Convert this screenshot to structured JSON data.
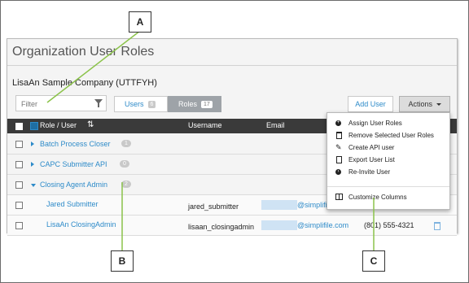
{
  "page": {
    "title": "Organization User Roles",
    "company": "LisaAn Sample Company (UTTFYH)"
  },
  "toolbar": {
    "filter_placeholder": "Filter",
    "users_tab": {
      "label": "Users",
      "count": "6"
    },
    "roles_tab": {
      "label": "Roles",
      "count": "17"
    },
    "add_user_label": "Add User",
    "actions_label": "Actions"
  },
  "table": {
    "headers": {
      "role_user": "Role / User",
      "username": "Username",
      "email": "Email"
    },
    "rows": [
      {
        "label": "Batch Process Closer",
        "count": "1"
      },
      {
        "label": "CAPC Submitter API",
        "count": "0"
      },
      {
        "label": "Closing Agent Admin",
        "count": "2"
      }
    ],
    "users": [
      {
        "name": "Jared Submitter",
        "username": "jared_submitter",
        "email": "@simplifile.com",
        "phone": ""
      },
      {
        "name": "LisaAn ClosingAdmin",
        "username": "lisaan_closingadmin",
        "email": "@simplifile.com",
        "phone": "(801) 555-4321"
      }
    ]
  },
  "actions_menu": [
    {
      "label": "Assign User Roles",
      "icon": "plus-circle-icon"
    },
    {
      "label": "Remove Selected User Roles",
      "icon": "trash-icon"
    },
    {
      "label": "Create API user",
      "icon": "pencil-icon"
    },
    {
      "label": "Export User List",
      "icon": "document-icon"
    },
    {
      "label": "Re-Invite User",
      "icon": "arrow-circle-icon"
    },
    {
      "label": "Customize Columns",
      "icon": "columns-icon"
    }
  ],
  "callouts": {
    "a": "A",
    "b": "B",
    "c": "C"
  },
  "colors": {
    "accent": "#2e8bc9",
    "header_bg": "#3a3a3a",
    "annotation_line": "#8bc34a"
  }
}
